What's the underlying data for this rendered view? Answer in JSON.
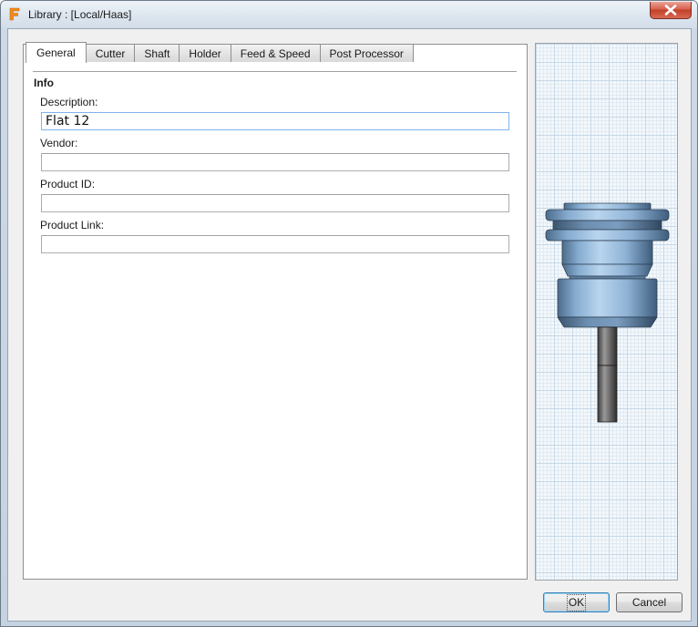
{
  "window": {
    "title": "Library :  [Local/Haas]",
    "app_icon": "fusion-f-icon",
    "close_icon": "close-x-icon"
  },
  "tabs": [
    {
      "label": "General",
      "active": true
    },
    {
      "label": "Cutter",
      "active": false
    },
    {
      "label": "Shaft",
      "active": false
    },
    {
      "label": "Holder",
      "active": false
    },
    {
      "label": "Feed & Speed",
      "active": false
    },
    {
      "label": "Post Processor",
      "active": false
    }
  ],
  "info": {
    "section_title": "Info",
    "description_label": "Description:",
    "description_value": "Flat 12",
    "vendor_label": "Vendor:",
    "vendor_value": "",
    "product_id_label": "Product ID:",
    "product_id_value": "",
    "product_link_label": "Product Link:",
    "product_link_value": ""
  },
  "buttons": {
    "ok_label": "OK",
    "cancel_label": "Cancel"
  },
  "colors": {
    "accent": "#3c7fb1",
    "holder_blue": "#7fa7cc",
    "close_red": "#c3402a"
  }
}
